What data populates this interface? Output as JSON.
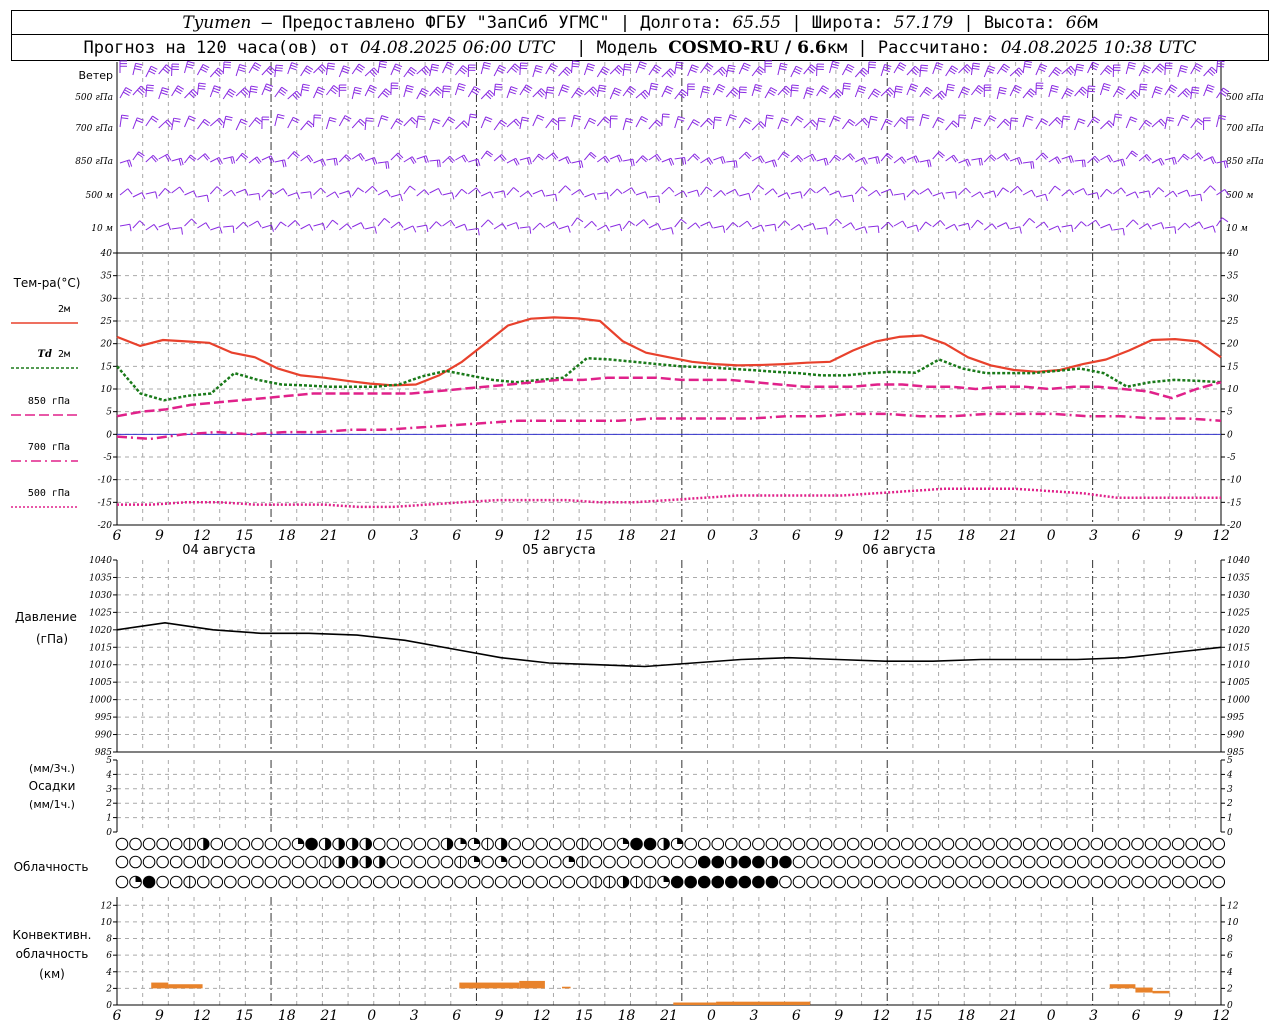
{
  "header": {
    "line1": {
      "city": "Tyumen",
      "provider": " – Предоставлено ФГБУ \"ЗапСиб УГМС\" | Долгота: ",
      "lon": "65.55",
      "lat_label": " | Широта: ",
      "lat": "57.179",
      "alt_label": " | Высота: ",
      "alt": "66",
      "alt_unit": "м"
    },
    "line2": {
      "forecast_label": "Прогноз на 120 часа(ов) от ",
      "start": "04.08.2025 06:00 UTC",
      "model_label": "  | Модель ",
      "model": "COSMO-RU / 6.6",
      "model_unit": "км | Рассчитано: ",
      "calc": "04.08.2025 10:38 UTC"
    }
  },
  "colors": {
    "wind": "#8a2be2",
    "t2m": "#e8412c",
    "td2m": "#1a7a1a",
    "t850": "#e0218a",
    "t700": "#e0218a",
    "t500": "#e0218a",
    "pressure": "#000000",
    "convective": "#e8822a",
    "zero_line": "#3333cc",
    "grid": "#aaaaaa"
  },
  "x_axis": {
    "hours": [
      "6",
      "9",
      "12",
      "15",
      "18",
      "21",
      "0",
      "3",
      "6",
      "9",
      "12",
      "15",
      "18",
      "21",
      "0",
      "3",
      "6",
      "9",
      "12",
      "15",
      "18",
      "21",
      "0",
      "3",
      "6",
      "9",
      "12"
    ],
    "dates": [
      "04 августа",
      "05 августа",
      "06 августа"
    ]
  },
  "wind_panel": {
    "title": "Ветер",
    "levels": [
      "500 гПа",
      "700 гПа",
      "850 гПа",
      "500 м",
      "10 м"
    ]
  },
  "temp_panel": {
    "ylabel": "Тем-ра(°C)",
    "yticks": [
      "40",
      "35",
      "30",
      "25",
      "20",
      "15",
      "10",
      "5",
      "0",
      "-5",
      "-10",
      "-15",
      "-20"
    ],
    "legend": [
      {
        "label": "2м",
        "italic": ""
      },
      {
        "label": " 2м",
        "italic": "Td"
      },
      {
        "label": "850 гПа",
        "italic": ""
      },
      {
        "label": "700 гПа",
        "italic": ""
      },
      {
        "label": "500 гПа",
        "italic": ""
      }
    ]
  },
  "pressure_panel": {
    "ylabel1": "Давление",
    "ylabel2": "(гПа)",
    "yticks": [
      "1040",
      "1035",
      "1030",
      "1025",
      "1020",
      "1015",
      "1010",
      "1005",
      "1000",
      "995",
      "990",
      "985"
    ]
  },
  "precip_panel": {
    "ylabel1": "(мм/3ч.)",
    "ylabel2": "Осадки",
    "ylabel3": "(мм/1ч.)",
    "yticks": [
      "5",
      "4",
      "3",
      "2",
      "1",
      "0"
    ]
  },
  "cloud_panel": {
    "ylabel": "Облачность"
  },
  "conv_panel": {
    "ylabel1": "Конвективн.",
    "ylabel2": "облачность",
    "ylabel3": "(км)",
    "yticks": [
      "12",
      "10",
      "8",
      "6",
      "4",
      "2",
      "0"
    ]
  },
  "chart_data": [
    {
      "type": "line",
      "title": "Тем-ра(°C)",
      "x": [
        0,
        3,
        6,
        9,
        12,
        15,
        18,
        21,
        24,
        27,
        30,
        33,
        36,
        39,
        42,
        45,
        48,
        51,
        54,
        57,
        60,
        63,
        66,
        69,
        72,
        75,
        78,
        81,
        84,
        87,
        90,
        93,
        96,
        99,
        102,
        105,
        108,
        111,
        114,
        117,
        120,
        123,
        126,
        129
      ],
      "ylim": [
        -20,
        40
      ],
      "series": [
        {
          "name": "2м",
          "values": [
            21.5,
            19.5,
            20.8,
            20.5,
            20.2,
            18,
            17,
            14.5,
            13,
            12.5,
            11.8,
            11.2,
            10.8,
            11,
            13,
            16,
            20,
            24,
            25.5,
            25.8,
            25.6,
            25,
            20.5,
            18,
            17,
            16,
            15.5,
            15.2,
            15.3,
            15.5,
            15.8,
            16,
            18.5,
            20.5,
            21.5,
            21.8,
            20,
            17,
            15.2,
            14.2,
            13.8,
            14.2,
            15.5,
            16.5,
            18.5,
            20.8,
            21,
            20.5,
            17
          ]
        },
        {
          "name": "Td 2м",
          "values": [
            15,
            9,
            7.5,
            8.5,
            9,
            13.5,
            12,
            11,
            10.8,
            10.5,
            10.5,
            10.5,
            11,
            12.8,
            14,
            13,
            12,
            11.5,
            12,
            12.5,
            16.8,
            16.5,
            16,
            15.5,
            15,
            14.8,
            14.5,
            14.2,
            13.8,
            13.5,
            13,
            13,
            13.5,
            13.8,
            13.6,
            16.5,
            14.5,
            13.5,
            13.5,
            13.5,
            14,
            14.5,
            13.5,
            10.5,
            11.5,
            12,
            11.8,
            11.5
          ]
        },
        {
          "name": "850 гПа",
          "values": [
            4,
            5,
            5.5,
            6.5,
            7,
            7.5,
            8,
            8.5,
            9,
            9,
            9,
            9,
            9,
            9.5,
            10,
            10.5,
            11,
            11.5,
            12,
            12,
            12.5,
            12.5,
            12.5,
            12,
            12,
            12,
            11.5,
            11,
            10.5,
            10.5,
            10.5,
            11,
            11,
            10.5,
            10.5,
            10,
            10.5,
            10.5,
            10,
            10.5,
            10.5,
            10,
            9.5,
            8,
            10,
            11.5
          ]
        },
        {
          "name": "700 гПа",
          "values": [
            -0.5,
            -1,
            0,
            0.5,
            0,
            0.5,
            0.5,
            1,
            1,
            1.5,
            2,
            2.5,
            3,
            3,
            3,
            3,
            3.5,
            3.5,
            3.5,
            3.5,
            4,
            4,
            4.5,
            4.5,
            4,
            4,
            4.5,
            4.5,
            4.5,
            4,
            4,
            3.5,
            3.5,
            3
          ]
        },
        {
          "name": "500 гПа",
          "values": [
            -15.5,
            -15.5,
            -15,
            -15,
            -15.5,
            -15.5,
            -15.5,
            -16,
            -16,
            -15.5,
            -15,
            -14.5,
            -14.5,
            -14.5,
            -15,
            -15,
            -14.5,
            -14,
            -13.5,
            -13.5,
            -13.5,
            -13.5,
            -13,
            -12.5,
            -12,
            -12,
            -12,
            -12.5,
            -13,
            -14,
            -14,
            -14,
            -14
          ]
        }
      ]
    },
    {
      "type": "line",
      "title": "Давление",
      "x": [
        0,
        6,
        12,
        18,
        24,
        30,
        36,
        42,
        48,
        54,
        60,
        66,
        72,
        78,
        84,
        90,
        96,
        102,
        108,
        114,
        120,
        126,
        129
      ],
      "ylim": [
        985,
        1040
      ],
      "series": [
        {
          "name": "Давление",
          "values": [
            1020,
            1022,
            1020,
            1019,
            1019,
            1018.5,
            1017,
            1014.5,
            1012,
            1010.5,
            1010,
            1009.5,
            1010.5,
            1011.5,
            1012,
            1011.5,
            1011,
            1011,
            1011.5,
            1011.5,
            1011.5,
            1012,
            1013.5,
            1015
          ]
        }
      ]
    },
    {
      "type": "bar",
      "title": "Конвективн. облачность (км)",
      "ylim": [
        0,
        13
      ],
      "segments": [
        {
          "start": 4,
          "end": 6,
          "base": 2,
          "top": 2.7
        },
        {
          "start": 6,
          "end": 10,
          "base": 2,
          "top": 2.5
        },
        {
          "start": 40,
          "end": 47,
          "base": 2,
          "top": 2.7
        },
        {
          "start": 47,
          "end": 50,
          "base": 2,
          "top": 2.9
        },
        {
          "start": 52,
          "end": 53,
          "base": 2,
          "top": 2.2
        },
        {
          "start": 65,
          "end": 70,
          "base": 0,
          "top": 0.3
        },
        {
          "start": 70,
          "end": 81,
          "base": 0,
          "top": 0.4
        },
        {
          "start": 116,
          "end": 119,
          "base": 2,
          "top": 2.5
        },
        {
          "start": 119,
          "end": 121,
          "base": 1.5,
          "top": 2.1
        },
        {
          "start": 121,
          "end": 123,
          "base": 1.4,
          "top": 1.7
        }
      ]
    }
  ],
  "cloud_rows": [
    [
      0,
      0,
      0,
      0,
      0,
      1,
      3,
      0,
      0,
      0,
      0,
      0,
      0,
      2,
      4,
      3,
      3,
      3,
      3,
      0,
      0,
      0,
      0,
      0,
      3,
      2,
      2,
      1,
      3,
      0,
      0,
      0,
      0,
      0,
      1,
      0,
      0,
      2,
      4,
      4,
      3,
      2,
      0,
      0,
      0,
      0,
      0,
      0,
      0,
      0,
      0,
      0,
      0,
      0,
      0,
      0,
      0,
      0,
      0,
      0,
      0,
      0,
      0,
      0,
      0,
      0,
      0,
      0,
      0,
      0,
      0,
      0,
      0,
      0,
      0,
      0,
      0,
      0,
      0,
      0,
      0,
      0
    ],
    [
      0,
      0,
      0,
      0,
      0,
      0,
      1,
      0,
      0,
      0,
      0,
      0,
      0,
      0,
      0,
      1,
      3,
      3,
      3,
      3,
      0,
      0,
      0,
      0,
      0,
      1,
      2,
      0,
      2,
      0,
      0,
      0,
      0,
      2,
      1,
      0,
      0,
      0,
      0,
      0,
      0,
      0,
      0,
      4,
      4,
      3,
      4,
      4,
      3,
      4,
      0,
      0,
      0,
      0,
      0,
      0,
      0,
      0,
      0,
      0,
      0,
      0,
      0,
      0,
      0,
      0,
      0,
      0,
      0,
      0,
      0,
      0,
      0,
      0,
      0,
      0,
      0,
      0,
      0,
      0,
      0,
      0
    ],
    [
      0,
      2,
      4,
      0,
      0,
      1,
      0,
      0,
      0,
      0,
      0,
      0,
      0,
      0,
      0,
      0,
      0,
      0,
      0,
      0,
      0,
      0,
      0,
      0,
      0,
      0,
      0,
      0,
      0,
      0,
      0,
      0,
      0,
      0,
      0,
      1,
      1,
      3,
      1,
      1,
      2,
      4,
      4,
      4,
      4,
      4,
      4,
      4,
      4,
      0,
      0,
      0,
      0,
      0,
      0,
      0,
      0,
      0,
      0,
      0,
      0,
      0,
      0,
      0,
      0,
      0,
      0,
      0,
      0,
      0,
      0,
      0,
      0,
      0,
      0,
      0,
      0,
      0,
      0,
      0,
      0,
      0
    ]
  ]
}
